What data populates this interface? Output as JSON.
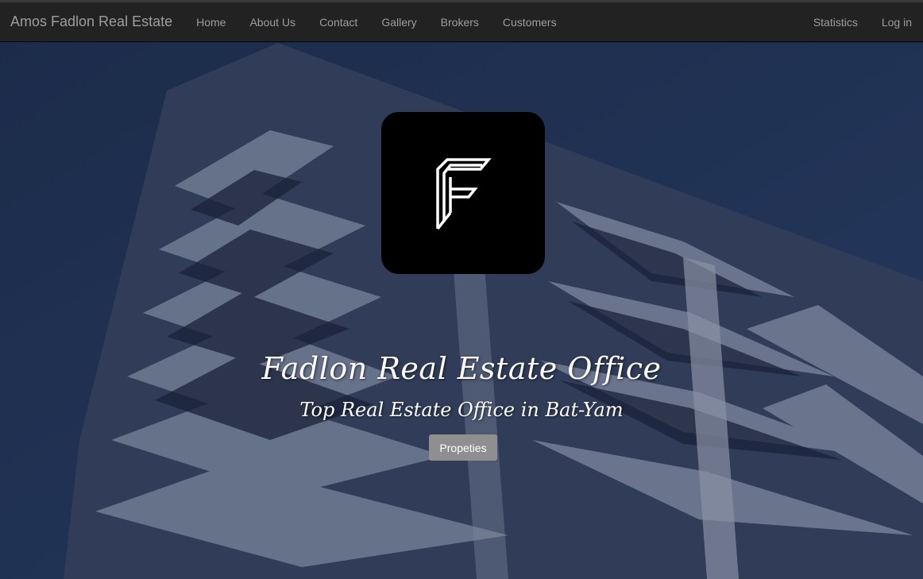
{
  "navbar": {
    "brand": "Amos Fadlon Real Estate",
    "left_links": [
      "Home",
      "About Us",
      "Contact",
      "Gallery",
      "Brokers",
      "Customers"
    ],
    "right_links": [
      "Statistics",
      "Log in"
    ]
  },
  "hero": {
    "background_image": "building-photo",
    "logo_icon": "stylized-f-logo-icon",
    "title": "Fadlon Real Estate Office",
    "subtitle": "Top Real Estate Office in Bat-Yam",
    "button_label": "Propeties"
  },
  "colors": {
    "navbar_bg": "#222222",
    "nav_text": "#9d9d9d",
    "logo_bg": "#000000",
    "button_bg": "#8f8f8f",
    "hero_text": "#ffffff"
  }
}
